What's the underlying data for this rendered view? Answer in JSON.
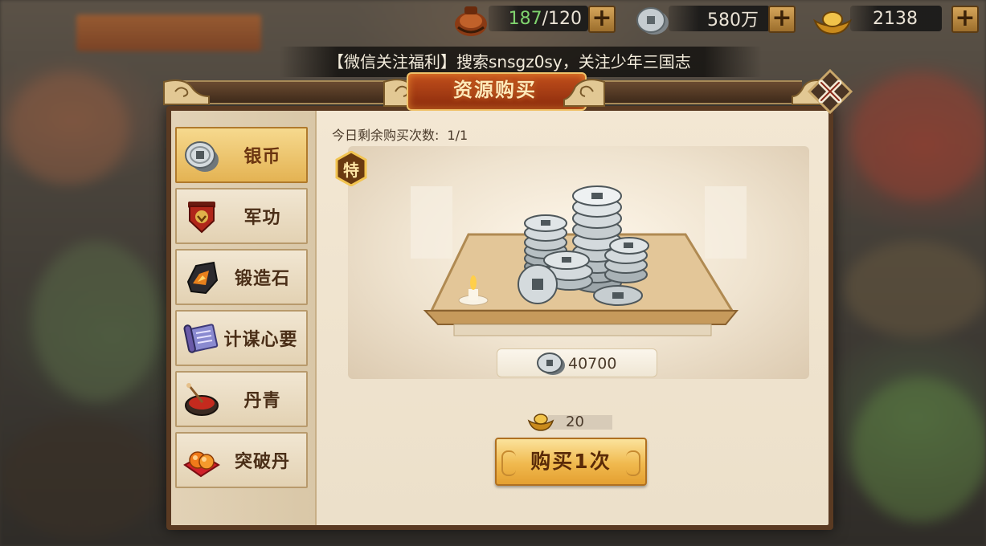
{
  "resources": [
    {
      "name": "stamina",
      "current": "187",
      "max": "/120"
    },
    {
      "name": "silver",
      "value": "580万"
    },
    {
      "name": "gold",
      "value": "2138"
    }
  ],
  "plus_label": "+",
  "marquee_text": "【微信关注福利】搜索snsgz0sy，关注少年三国志",
  "dialog": {
    "title": "资源购买",
    "quota_label": "今日剩余购买次数:",
    "quota_value": "1/1",
    "special_badge": "特",
    "reward_amount": "40700",
    "cost": "20",
    "buy_label": "购买1次"
  },
  "sidebar": {
    "items": [
      {
        "label": "银币",
        "icon": "silver-coin-icon",
        "active": true
      },
      {
        "label": "军功",
        "icon": "military-merit-icon",
        "active": false
      },
      {
        "label": "锻造石",
        "icon": "forging-stone-icon",
        "active": false
      },
      {
        "label": "计谋心要",
        "icon": "strategy-scroll-icon",
        "active": false
      },
      {
        "label": "丹青",
        "icon": "paint-bowl-icon",
        "active": false
      },
      {
        "label": "突破丹",
        "icon": "breakthrough-pill-icon",
        "active": false
      }
    ]
  },
  "colors": {
    "accent_gold": "#f0b94e",
    "panel_bg": "#f3e7d3",
    "frame_brown": "#5a3a22",
    "title_red": "#c2501c",
    "stamina_green": "#7fd36e"
  }
}
